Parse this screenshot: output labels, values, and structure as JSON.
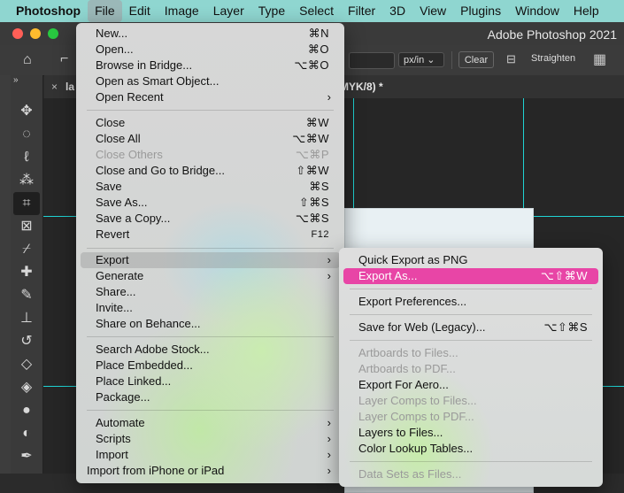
{
  "menubar": {
    "app": "Photoshop",
    "items": [
      "File",
      "Edit",
      "Image",
      "Layer",
      "Type",
      "Select",
      "Filter",
      "3D",
      "View",
      "Plugins",
      "Window",
      "Help"
    ]
  },
  "window": {
    "title": "Adobe Photoshop 2021"
  },
  "options_bar": {
    "unit": "px/in",
    "clear": "Clear",
    "straighten": "Straighten"
  },
  "doc_tab": {
    "name_start": "la",
    "name_end": "MYK/8) *"
  },
  "toolbar": {
    "collapse": "»"
  },
  "file_menu": {
    "items": [
      {
        "label": "New...",
        "shortcut": "⌘N"
      },
      {
        "label": "Open...",
        "shortcut": "⌘O"
      },
      {
        "label": "Browse in Bridge...",
        "shortcut": "⌥⌘O"
      },
      {
        "label": "Open as Smart Object...",
        "shortcut": ""
      },
      {
        "label": "Open Recent",
        "shortcut": "",
        "submenu": true
      },
      {
        "label": "Close",
        "shortcut": "⌘W"
      },
      {
        "label": "Close All",
        "shortcut": "⌥⌘W"
      },
      {
        "label": "Close Others",
        "shortcut": "⌥⌘P",
        "disabled": true
      },
      {
        "label": "Close and Go to Bridge...",
        "shortcut": "⇧⌘W"
      },
      {
        "label": "Save",
        "shortcut": "⌘S"
      },
      {
        "label": "Save As...",
        "shortcut": "⇧⌘S"
      },
      {
        "label": "Save a Copy...",
        "shortcut": "⌥⌘S"
      },
      {
        "label": "Revert",
        "shortcut": "F12"
      },
      {
        "label": "Export",
        "shortcut": "",
        "submenu": true,
        "highlighted": true
      },
      {
        "label": "Generate",
        "shortcut": "",
        "submenu": true
      },
      {
        "label": "Share...",
        "shortcut": ""
      },
      {
        "label": "Invite...",
        "shortcut": ""
      },
      {
        "label": "Share on Behance...",
        "shortcut": ""
      },
      {
        "label": "Search Adobe Stock...",
        "shortcut": ""
      },
      {
        "label": "Place Embedded...",
        "shortcut": ""
      },
      {
        "label": "Place Linked...",
        "shortcut": ""
      },
      {
        "label": "Package...",
        "shortcut": ""
      },
      {
        "label": "Automate",
        "shortcut": "",
        "submenu": true
      },
      {
        "label": "Scripts",
        "shortcut": "",
        "submenu": true
      },
      {
        "label": "Import",
        "shortcut": "",
        "submenu": true
      },
      {
        "label": "Import from iPhone or iPad",
        "shortcut": "",
        "submenu": true
      }
    ]
  },
  "export_menu": {
    "items": [
      {
        "label": "Quick Export as PNG",
        "shortcut": ""
      },
      {
        "label": "Export As...",
        "shortcut": "⌥⇧⌘W",
        "highlighted": true
      },
      {
        "label": "Export Preferences...",
        "shortcut": ""
      },
      {
        "label": "Save for Web (Legacy)...",
        "shortcut": "⌥⇧⌘S"
      },
      {
        "label": "Artboards to Files...",
        "shortcut": "",
        "disabled": true
      },
      {
        "label": "Artboards to PDF...",
        "shortcut": "",
        "disabled": true
      },
      {
        "label": "Export For Aero...",
        "shortcut": ""
      },
      {
        "label": "Layer Comps to Files...",
        "shortcut": "",
        "disabled": true
      },
      {
        "label": "Layer Comps to PDF...",
        "shortcut": "",
        "disabled": true
      },
      {
        "label": "Layers to Files...",
        "shortcut": ""
      },
      {
        "label": "Color Lookup Tables...",
        "shortcut": ""
      },
      {
        "label": "Data Sets as Files...",
        "shortcut": "",
        "disabled": true
      }
    ]
  },
  "colors": {
    "highlight": "#e845a6",
    "guide": "#1fd3d3",
    "menubar": "#8fd6d0"
  }
}
